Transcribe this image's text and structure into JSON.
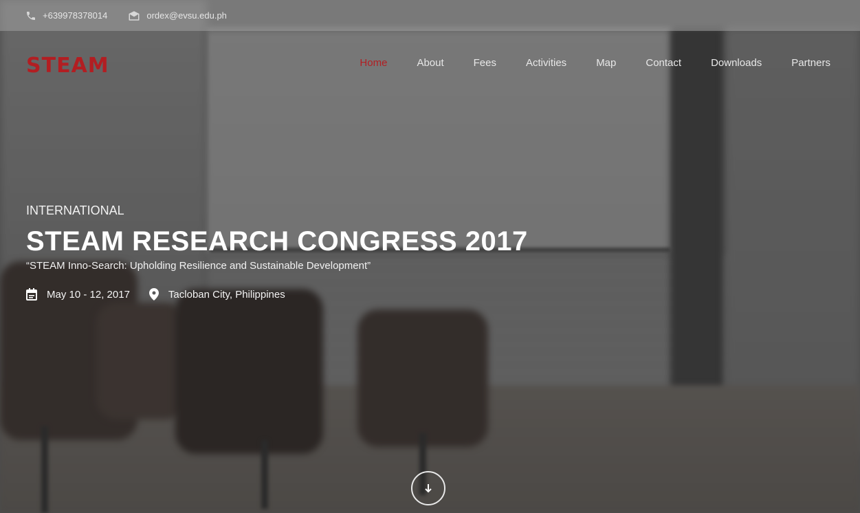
{
  "topbar": {
    "phone": "+639978378014",
    "email": "ordex@evsu.edu.ph",
    "phone_icon": "phone-icon",
    "email_icon": "envelope-icon"
  },
  "brand": {
    "logo_text": "STEAM",
    "accent_color": "#b21e22"
  },
  "nav": {
    "items": [
      {
        "label": "Home",
        "active": true
      },
      {
        "label": "About",
        "active": false
      },
      {
        "label": "Fees",
        "active": false
      },
      {
        "label": "Activities",
        "active": false
      },
      {
        "label": "Map",
        "active": false
      },
      {
        "label": "Contact",
        "active": false
      },
      {
        "label": "Downloads",
        "active": false
      },
      {
        "label": "Partners",
        "active": false
      }
    ]
  },
  "hero": {
    "kicker": "INTERNATIONAL",
    "title": "STEAM RESEARCH CONGRESS 2017",
    "tagline": "“STEAM Inno-Search: Upholding Resilience and Sustainable Development”",
    "date": "May 10 - 12, 2017",
    "location": "Tacloban City, Philippines",
    "date_icon": "calendar-icon",
    "location_icon": "map-pin-icon"
  },
  "scroll_button": {
    "icon": "arrow-down-icon"
  }
}
